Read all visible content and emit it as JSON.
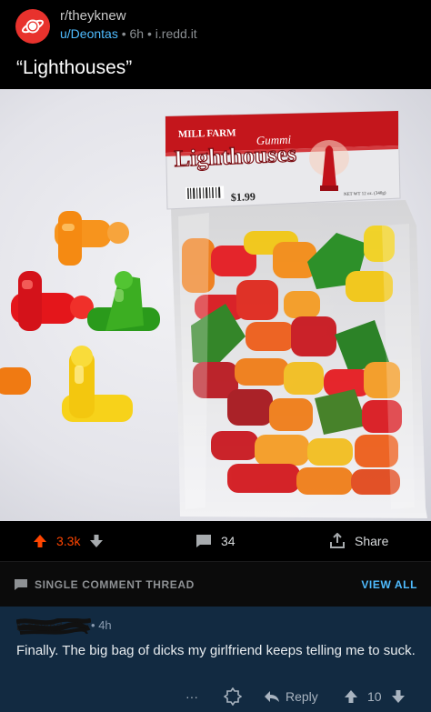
{
  "post": {
    "subreddit": "r/theyknew",
    "author": "u/Deontas",
    "age": "6h",
    "domain": "i.redd.it",
    "separator": "•",
    "title": "“Lighthouses”"
  },
  "image": {
    "package": {
      "brand": "MILL FARM",
      "product_sub": "Gummi",
      "product_name": "Lighthouses",
      "price": "$1.99",
      "net_wt": "NET WT 12 oz. (340g)"
    }
  },
  "actions": {
    "score": "3.3k",
    "comments": "34",
    "share": "Share"
  },
  "thread": {
    "label": "SINGLE COMMENT THREAD",
    "view_all": "VIEW ALL"
  },
  "comment": {
    "author": "redacted",
    "age": "4h",
    "separator": "•",
    "body": "Finally.  The big bag of dicks my girlfriend keeps telling me to suck.",
    "more": "···",
    "reply": "Reply",
    "score": "10"
  },
  "colors": {
    "accent_orange": "#ff4500",
    "link_blue": "#4fbcff",
    "comment_bg": "#122a41"
  }
}
